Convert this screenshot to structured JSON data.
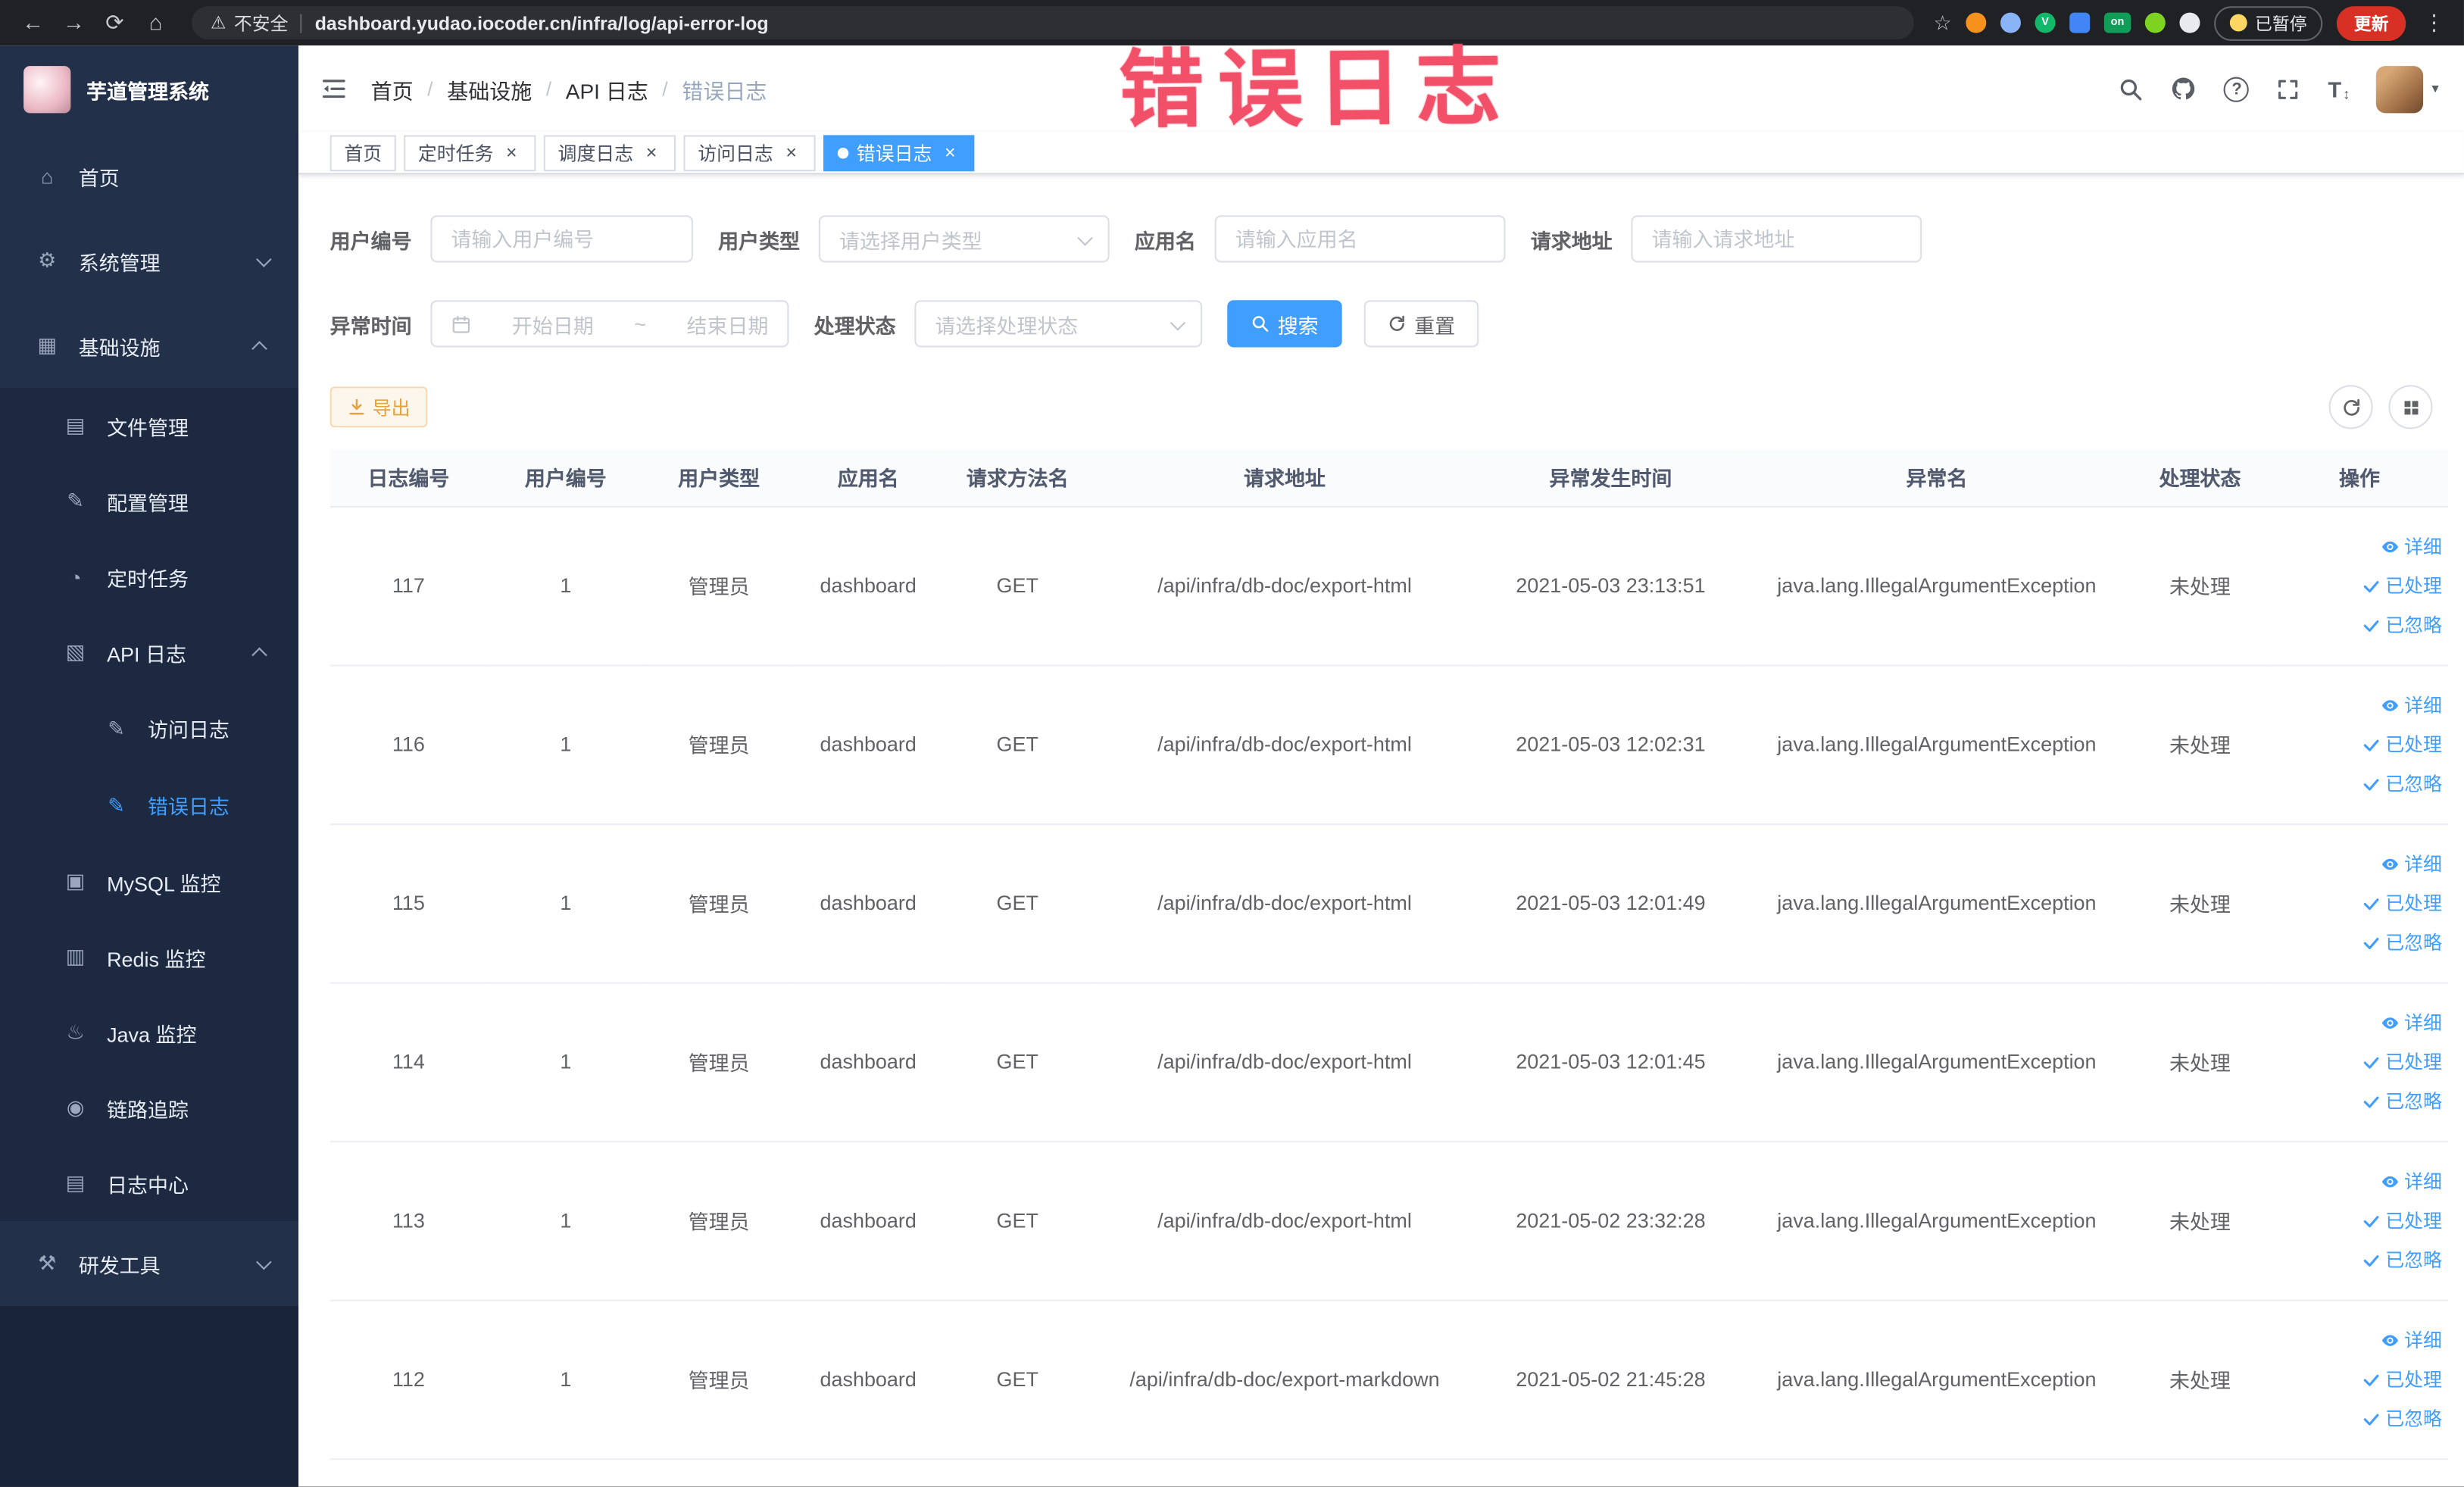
{
  "colors": {
    "accent": "#409eff",
    "warning": "#e6a23c",
    "sidebar_bg": "#22304a",
    "sidebar_submenu_bg": "#1c2940",
    "annotation": "#f25069",
    "chrome_bg": "#202124"
  },
  "browser": {
    "security_label": "不安全",
    "url": "dashboard.yudao.iocoder.cn/infra/log/api-error-log",
    "paused_badge": "已暂停",
    "update_button": "更新"
  },
  "annotation": {
    "text": "错误日志"
  },
  "icons": {
    "back": "←",
    "forward": "→",
    "reload": "⟳",
    "home": "⌂",
    "warning": "⚠",
    "star": "☆",
    "more": "⋮",
    "caret": "▾",
    "close": "×",
    "separator": "/",
    "question": "?",
    "fontsize": "T",
    "updown": "↕",
    "ext_on": "on",
    "ext_v": "V",
    "menu_home": "⌂",
    "menu_system": "⚙",
    "menu_infra": "▦",
    "menu_file": "▤",
    "menu_config": "✎",
    "menu_job": "◔",
    "menu_apilog": "▧",
    "menu_accesslog": "✎",
    "menu_errorlog": "✎",
    "menu_mysql": "▣",
    "menu_redis": "▥",
    "menu_java": "♨",
    "menu_trace": "◉",
    "menu_logcenter": "▤",
    "menu_tool": "⚒"
  },
  "sidebar": {
    "logo_title": "芋道管理系统",
    "items": [
      {
        "label": "首页"
      },
      {
        "label": "系统管理"
      },
      {
        "label": "基础设施"
      },
      {
        "label": "文件管理"
      },
      {
        "label": "配置管理"
      },
      {
        "label": "定时任务"
      },
      {
        "label": "API 日志"
      },
      {
        "label": "访问日志"
      },
      {
        "label": "错误日志"
      },
      {
        "label": "MySQL 监控"
      },
      {
        "label": "Redis 监控"
      },
      {
        "label": "Java 监控"
      },
      {
        "label": "链路追踪"
      },
      {
        "label": "日志中心"
      },
      {
        "label": "研发工具"
      }
    ]
  },
  "breadcrumb": {
    "separator": "/",
    "items": [
      "首页",
      "基础设施",
      "API 日志",
      "错误日志"
    ]
  },
  "tabs": [
    {
      "label": "首页"
    },
    {
      "label": "定时任务"
    },
    {
      "label": "调度日志"
    },
    {
      "label": "访问日志"
    },
    {
      "label": "错误日志"
    }
  ],
  "filters": {
    "user_id_label": "用户编号",
    "user_id_placeholder": "请输入用户编号",
    "user_type_label": "用户类型",
    "user_type_placeholder": "请选择用户类型",
    "app_name_label": "应用名",
    "app_name_placeholder": "请输入应用名",
    "request_url_label": "请求地址",
    "request_url_placeholder": "请输入请求地址",
    "exception_time_label": "异常时间",
    "start_placeholder": "开始日期",
    "range_separator": "~",
    "end_placeholder": "结束日期",
    "process_status_label": "处理状态",
    "process_status_placeholder": "请选择处理状态",
    "search_button": "搜索",
    "reset_button": "重置"
  },
  "toolbar": {
    "export_button": "导出"
  },
  "table": {
    "columns": [
      "日志编号",
      "用户编号",
      "用户类型",
      "应用名",
      "请求方法名",
      "请求地址",
      "异常发生时间",
      "异常名",
      "处理状态",
      "操作"
    ],
    "actions": {
      "detail": "详细",
      "processed": "已处理",
      "ignored": "已忽略"
    },
    "rows": [
      {
        "id": "117",
        "user_id": "1",
        "user_type": "管理员",
        "app": "dashboard",
        "method": "GET",
        "url": "/api/infra/db-doc/export-html",
        "time": "2021-05-03 23:13:51",
        "exception": "java.lang.IllegalArgumentException",
        "status": "未处理"
      },
      {
        "id": "116",
        "user_id": "1",
        "user_type": "管理员",
        "app": "dashboard",
        "method": "GET",
        "url": "/api/infra/db-doc/export-html",
        "time": "2021-05-03 12:02:31",
        "exception": "java.lang.IllegalArgumentException",
        "status": "未处理"
      },
      {
        "id": "115",
        "user_id": "1",
        "user_type": "管理员",
        "app": "dashboard",
        "method": "GET",
        "url": "/api/infra/db-doc/export-html",
        "time": "2021-05-03 12:01:49",
        "exception": "java.lang.IllegalArgumentException",
        "status": "未处理"
      },
      {
        "id": "114",
        "user_id": "1",
        "user_type": "管理员",
        "app": "dashboard",
        "method": "GET",
        "url": "/api/infra/db-doc/export-html",
        "time": "2021-05-03 12:01:45",
        "exception": "java.lang.IllegalArgumentException",
        "status": "未处理"
      },
      {
        "id": "113",
        "user_id": "1",
        "user_type": "管理员",
        "app": "dashboard",
        "method": "GET",
        "url": "/api/infra/db-doc/export-html",
        "time": "2021-05-02 23:32:28",
        "exception": "java.lang.IllegalArgumentException",
        "status": "未处理"
      },
      {
        "id": "112",
        "user_id": "1",
        "user_type": "管理员",
        "app": "dashboard",
        "method": "GET",
        "url": "/api/infra/db-doc/export-markdown",
        "time": "2021-05-02 21:45:28",
        "exception": "java.lang.IllegalArgumentException",
        "status": "未处理"
      }
    ]
  }
}
